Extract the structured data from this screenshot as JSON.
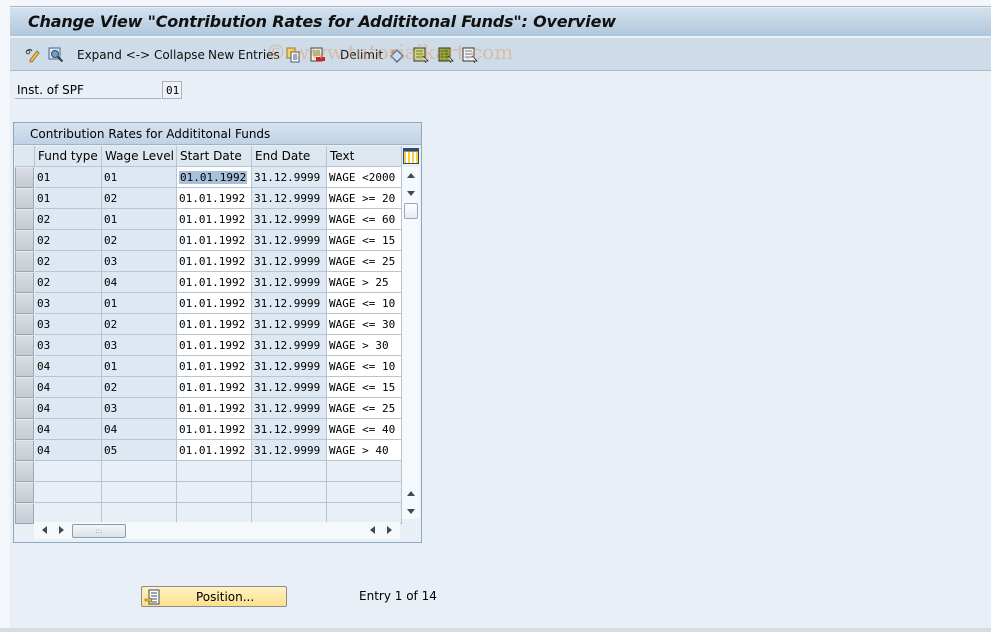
{
  "window": {
    "title": "Change View \"Contribution Rates for Addititonal Funds\": Overview"
  },
  "toolbar": {
    "items": [
      {
        "name": "display-change-icon",
        "label": ""
      },
      {
        "name": "find-icon",
        "label": ""
      },
      {
        "name": "expand-collapse",
        "label": "Expand <-> Collapse"
      },
      {
        "name": "new-entries",
        "label": "New Entries"
      },
      {
        "name": "copy-icon",
        "label": ""
      },
      {
        "name": "delete-icon",
        "label": ""
      },
      {
        "name": "delimit",
        "label": "Delimit"
      },
      {
        "name": "undo-change-icon",
        "label": ""
      },
      {
        "name": "select-all-icon",
        "label": ""
      },
      {
        "name": "select-block-icon",
        "label": ""
      },
      {
        "name": "deselect-all-icon",
        "label": ""
      }
    ],
    "watermark": "© www.tutorialkart.com"
  },
  "header_field": {
    "label": "Inst. of SPF",
    "value": "01"
  },
  "table": {
    "title": "Contribution Rates for Addititonal Funds",
    "columns": [
      "Fund type",
      "Wage Level",
      "Start Date",
      "End Date",
      "Text"
    ],
    "rows": [
      [
        "01",
        "01",
        "01.01.1992",
        "31.12.9999",
        "WAGE <2000"
      ],
      [
        "01",
        "02",
        "01.01.1992",
        "31.12.9999",
        "WAGE >= 20"
      ],
      [
        "02",
        "01",
        "01.01.1992",
        "31.12.9999",
        "WAGE <= 60"
      ],
      [
        "02",
        "02",
        "01.01.1992",
        "31.12.9999",
        "WAGE <= 15"
      ],
      [
        "02",
        "03",
        "01.01.1992",
        "31.12.9999",
        "WAGE <= 25"
      ],
      [
        "02",
        "04",
        "01.01.1992",
        "31.12.9999",
        "WAGE >  25"
      ],
      [
        "03",
        "01",
        "01.01.1992",
        "31.12.9999",
        "WAGE <= 10"
      ],
      [
        "03",
        "02",
        "01.01.1992",
        "31.12.9999",
        "WAGE <= 30"
      ],
      [
        "03",
        "03",
        "01.01.1992",
        "31.12.9999",
        "WAGE >  30"
      ],
      [
        "04",
        "01",
        "01.01.1992",
        "31.12.9999",
        "WAGE <= 10"
      ],
      [
        "04",
        "02",
        "01.01.1992",
        "31.12.9999",
        "WAGE <= 15"
      ],
      [
        "04",
        "03",
        "01.01.1992",
        "31.12.9999",
        "WAGE <= 25"
      ],
      [
        "04",
        "04",
        "01.01.1992",
        "31.12.9999",
        "WAGE <= 40"
      ],
      [
        "04",
        "05",
        "01.01.1992",
        "31.12.9999",
        "WAGE >  40"
      ]
    ],
    "empty_rows": 3,
    "hscroll_grip": ":::"
  },
  "footer": {
    "position_button": "Position...",
    "entry_info": "Entry 1 of 14"
  }
}
